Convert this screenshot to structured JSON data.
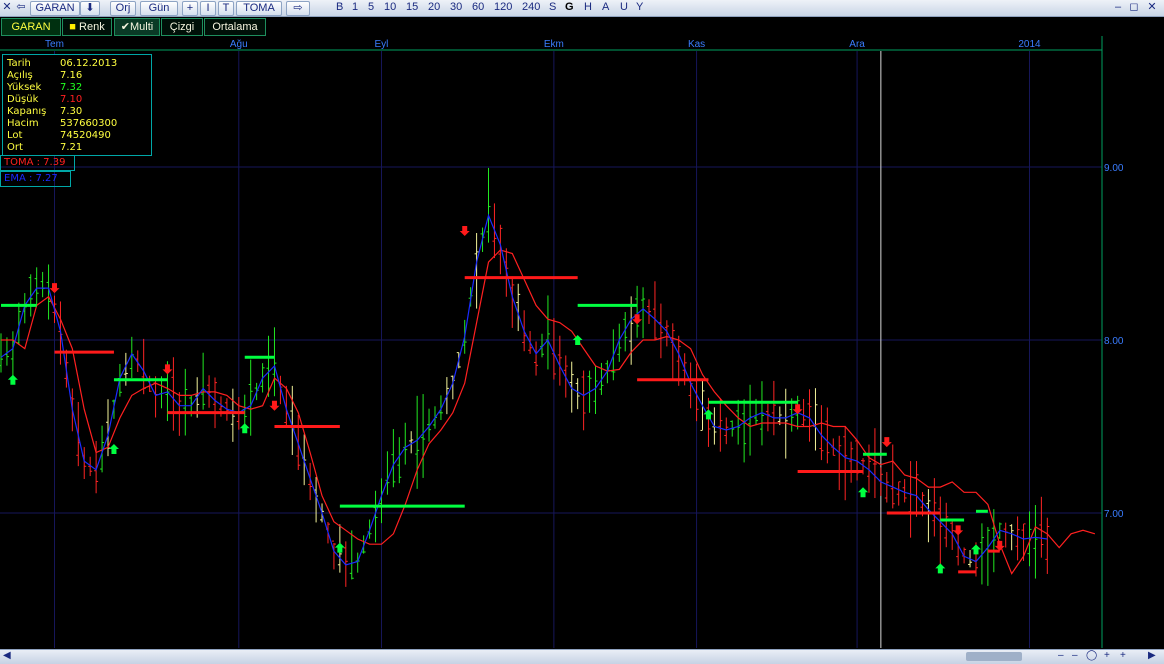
{
  "toolbar": {
    "symbol": "GARAN",
    "btn_orj": "Orj",
    "btn_gun": "Gün",
    "btn_plus": "+",
    "btn_i": "I",
    "btn_t": "T",
    "btn_toma": "TOMA",
    "periods": [
      "B",
      "1",
      "5",
      "10",
      "15",
      "20",
      "30",
      "60",
      "120",
      "240",
      "S",
      "G",
      "H",
      "A",
      "U",
      "Y"
    ]
  },
  "tabs": {
    "symbol": "GARAN",
    "renk": "Renk",
    "multi": "Multi",
    "cizgi": "Çizgi",
    "ortalama": "Ortalama"
  },
  "info": {
    "tarih_label": "Tarih",
    "tarih": "06.12.2013",
    "acilis_label": "Açılış",
    "acilis": "7.16",
    "yuksek_label": "Yüksek",
    "yuksek": "7.32",
    "dusuk_label": "Düşük",
    "dusuk": "7.10",
    "kapanis_label": "Kapanış",
    "kapanis": "7.30",
    "hacim_label": "Hacim",
    "hacim": "537660300",
    "lot_label": "Lot",
    "lot": "74520490",
    "ort_label": "Ort",
    "ort": "7.21"
  },
  "indicators": {
    "toma": "TOMA : 7.39",
    "ema": "EMA : 7.27"
  },
  "colors": {
    "background": "#000000",
    "grid": "#16165a",
    "axis_text": "#3a7dff",
    "axis_line": "#00a060",
    "toma": "#ff2020",
    "ema": "#1a2cff",
    "buy": "#00ff40",
    "sell": "#ff1a1a",
    "bar_green": "#21e821",
    "bar_red": "#ff2424",
    "bar_yellow": "#f3f39a"
  },
  "chart_data": {
    "type": "ohlc",
    "ylim": [
      6.22,
      9.67
    ],
    "y_ticks": [
      9.0,
      8.0,
      7.0
    ],
    "y_tick_labels": [
      "9.00",
      "8.00",
      "7.00"
    ],
    "x_labels": [
      {
        "label": "Tem",
        "index": 9
      },
      {
        "label": "Ağu",
        "index": 40
      },
      {
        "label": "Eyl",
        "index": 64
      },
      {
        "label": "Ekm",
        "index": 93
      },
      {
        "label": "Kas",
        "index": 117
      },
      {
        "label": "Ara",
        "index": 144
      },
      {
        "label": "2014",
        "index": 173
      }
    ],
    "cursor_index": 148,
    "toma_curve": [
      [
        0,
        8.0
      ],
      [
        2,
        8.0
      ],
      [
        4,
        7.95
      ],
      [
        6,
        8.2
      ],
      [
        8,
        8.25
      ],
      [
        10,
        8.12
      ],
      [
        12,
        7.95
      ],
      [
        14,
        7.6
      ],
      [
        16,
        7.35
      ],
      [
        18,
        7.38
      ],
      [
        20,
        7.55
      ],
      [
        22,
        7.68
      ],
      [
        24,
        7.72
      ],
      [
        26,
        7.75
      ],
      [
        28,
        7.72
      ],
      [
        30,
        7.68
      ],
      [
        32,
        7.68
      ],
      [
        34,
        7.7
      ],
      [
        36,
        7.7
      ],
      [
        38,
        7.68
      ],
      [
        40,
        7.62
      ],
      [
        42,
        7.6
      ],
      [
        44,
        7.62
      ],
      [
        46,
        7.78
      ],
      [
        48,
        7.72
      ],
      [
        50,
        7.58
      ],
      [
        52,
        7.35
      ],
      [
        54,
        7.1
      ],
      [
        56,
        6.95
      ],
      [
        58,
        6.9
      ],
      [
        60,
        6.85
      ],
      [
        62,
        6.82
      ],
      [
        64,
        6.82
      ],
      [
        66,
        6.88
      ],
      [
        68,
        7.05
      ],
      [
        70,
        7.25
      ],
      [
        72,
        7.4
      ],
      [
        74,
        7.48
      ],
      [
        76,
        7.58
      ],
      [
        78,
        7.75
      ],
      [
        80,
        8.1
      ],
      [
        82,
        8.45
      ],
      [
        84,
        8.52
      ],
      [
        86,
        8.5
      ],
      [
        88,
        8.35
      ],
      [
        90,
        8.2
      ],
      [
        92,
        8.12
      ],
      [
        94,
        8.1
      ],
      [
        96,
        8.05
      ],
      [
        98,
        7.95
      ],
      [
        100,
        7.85
      ],
      [
        102,
        7.82
      ],
      [
        104,
        7.83
      ],
      [
        106,
        7.93
      ],
      [
        108,
        8.0
      ],
      [
        110,
        8.0
      ],
      [
        112,
        8.02
      ],
      [
        114,
        8.0
      ],
      [
        116,
        7.95
      ],
      [
        118,
        7.8
      ],
      [
        120,
        7.7
      ],
      [
        122,
        7.62
      ],
      [
        124,
        7.55
      ],
      [
        126,
        7.5
      ],
      [
        128,
        7.52
      ],
      [
        130,
        7.52
      ],
      [
        132,
        7.52
      ],
      [
        134,
        7.5
      ],
      [
        136,
        7.5
      ],
      [
        138,
        7.52
      ],
      [
        140,
        7.5
      ],
      [
        142,
        7.5
      ],
      [
        144,
        7.42
      ],
      [
        146,
        7.32
      ],
      [
        148,
        7.28
      ],
      [
        150,
        7.3
      ],
      [
        152,
        7.22
      ],
      [
        154,
        7.2
      ],
      [
        156,
        7.15
      ],
      [
        158,
        7.15
      ],
      [
        160,
        7.18
      ],
      [
        162,
        7.12
      ],
      [
        164,
        7.12
      ],
      [
        166,
        7.05
      ],
      [
        168,
        6.82
      ],
      [
        170,
        6.65
      ],
      [
        172,
        6.75
      ],
      [
        174,
        6.92
      ],
      [
        176,
        6.88
      ],
      [
        178,
        6.8
      ],
      [
        180,
        6.88
      ],
      [
        182,
        6.9
      ],
      [
        184,
        6.88
      ]
    ],
    "ema_curve": [
      [
        0,
        7.9
      ],
      [
        2,
        7.95
      ],
      [
        4,
        8.2
      ],
      [
        6,
        8.3
      ],
      [
        8,
        8.3
      ],
      [
        10,
        8.05
      ],
      [
        12,
        7.6
      ],
      [
        14,
        7.3
      ],
      [
        16,
        7.25
      ],
      [
        18,
        7.45
      ],
      [
        20,
        7.78
      ],
      [
        22,
        7.92
      ],
      [
        24,
        7.82
      ],
      [
        26,
        7.68
      ],
      [
        28,
        7.7
      ],
      [
        30,
        7.62
      ],
      [
        32,
        7.62
      ],
      [
        34,
        7.72
      ],
      [
        36,
        7.65
      ],
      [
        38,
        7.6
      ],
      [
        40,
        7.58
      ],
      [
        42,
        7.62
      ],
      [
        44,
        7.78
      ],
      [
        46,
        7.85
      ],
      [
        48,
        7.6
      ],
      [
        50,
        7.4
      ],
      [
        52,
        7.2
      ],
      [
        54,
        7.0
      ],
      [
        56,
        6.78
      ],
      [
        58,
        6.7
      ],
      [
        60,
        6.72
      ],
      [
        62,
        6.9
      ],
      [
        64,
        7.1
      ],
      [
        66,
        7.28
      ],
      [
        68,
        7.38
      ],
      [
        70,
        7.42
      ],
      [
        72,
        7.5
      ],
      [
        74,
        7.6
      ],
      [
        76,
        7.75
      ],
      [
        78,
        8.02
      ],
      [
        80,
        8.45
      ],
      [
        82,
        8.72
      ],
      [
        84,
        8.55
      ],
      [
        86,
        8.25
      ],
      [
        88,
        8.05
      ],
      [
        90,
        7.92
      ],
      [
        92,
        8.0
      ],
      [
        94,
        7.85
      ],
      [
        96,
        7.72
      ],
      [
        98,
        7.68
      ],
      [
        100,
        7.72
      ],
      [
        102,
        7.82
      ],
      [
        104,
        8.0
      ],
      [
        106,
        8.12
      ],
      [
        108,
        8.18
      ],
      [
        110,
        8.12
      ],
      [
        112,
        8.05
      ],
      [
        114,
        7.92
      ],
      [
        116,
        7.75
      ],
      [
        118,
        7.62
      ],
      [
        120,
        7.5
      ],
      [
        122,
        7.48
      ],
      [
        124,
        7.5
      ],
      [
        126,
        7.55
      ],
      [
        128,
        7.58
      ],
      [
        130,
        7.55
      ],
      [
        132,
        7.55
      ],
      [
        134,
        7.58
      ],
      [
        136,
        7.55
      ],
      [
        138,
        7.45
      ],
      [
        140,
        7.38
      ],
      [
        142,
        7.32
      ],
      [
        144,
        7.3
      ],
      [
        146,
        7.25
      ],
      [
        148,
        7.18
      ],
      [
        150,
        7.15
      ],
      [
        152,
        7.12
      ],
      [
        154,
        7.1
      ],
      [
        156,
        7.02
      ],
      [
        158,
        6.95
      ],
      [
        160,
        6.88
      ],
      [
        162,
        6.75
      ],
      [
        164,
        6.72
      ],
      [
        166,
        6.8
      ],
      [
        168,
        6.9
      ],
      [
        170,
        6.88
      ],
      [
        172,
        6.85
      ],
      [
        174,
        6.86
      ],
      [
        176,
        6.85
      ]
    ],
    "signal_lines": [
      {
        "c": "buy",
        "i0": 0,
        "i1": 6,
        "v": 8.2
      },
      {
        "c": "sell",
        "i0": 9,
        "i1": 19,
        "v": 7.93
      },
      {
        "c": "buy",
        "i0": 19,
        "i1": 28,
        "v": 7.77
      },
      {
        "c": "sell",
        "i0": 28,
        "i1": 41,
        "v": 7.58
      },
      {
        "c": "buy",
        "i0": 41,
        "i1": 46,
        "v": 7.9
      },
      {
        "c": "sell",
        "i0": 46,
        "i1": 57,
        "v": 7.5
      },
      {
        "c": "buy",
        "i0": 57,
        "i1": 78,
        "v": 7.04
      },
      {
        "c": "sell",
        "i0": 78,
        "i1": 97,
        "v": 8.36
      },
      {
        "c": "buy",
        "i0": 97,
        "i1": 107,
        "v": 8.2
      },
      {
        "c": "sell",
        "i0": 107,
        "i1": 119,
        "v": 7.77
      },
      {
        "c": "buy",
        "i0": 119,
        "i1": 134,
        "v": 7.64
      },
      {
        "c": "sell",
        "i0": 134,
        "i1": 145,
        "v": 7.24
      },
      {
        "c": "buy",
        "i0": 145,
        "i1": 149,
        "v": 7.34
      },
      {
        "c": "sell",
        "i0": 149,
        "i1": 158,
        "v": 7.0
      },
      {
        "c": "buy",
        "i0": 158,
        "i1": 162,
        "v": 6.96
      },
      {
        "c": "sell",
        "i0": 161,
        "i1": 164,
        "v": 6.66
      },
      {
        "c": "buy",
        "i0": 164,
        "i1": 166,
        "v": 7.01
      },
      {
        "c": "sell",
        "i0": 166,
        "i1": 168,
        "v": 6.78
      }
    ],
    "arrows": [
      {
        "c": "buy",
        "i": 2,
        "v": 7.77
      },
      {
        "c": "sell",
        "i": 9,
        "v": 8.3
      },
      {
        "c": "buy",
        "i": 19,
        "v": 7.37
      },
      {
        "c": "sell",
        "i": 28,
        "v": 7.83
      },
      {
        "c": "buy",
        "i": 41,
        "v": 7.49
      },
      {
        "c": "sell",
        "i": 46,
        "v": 7.62
      },
      {
        "c": "buy",
        "i": 57,
        "v": 6.8
      },
      {
        "c": "sell",
        "i": 78,
        "v": 8.63
      },
      {
        "c": "buy",
        "i": 97,
        "v": 8.0
      },
      {
        "c": "sell",
        "i": 107,
        "v": 8.12
      },
      {
        "c": "buy",
        "i": 119,
        "v": 7.57
      },
      {
        "c": "sell",
        "i": 134,
        "v": 7.6
      },
      {
        "c": "buy",
        "i": 145,
        "v": 7.12
      },
      {
        "c": "sell",
        "i": 149,
        "v": 7.41
      },
      {
        "c": "buy",
        "i": 158,
        "v": 6.68
      },
      {
        "c": "sell",
        "i": 161,
        "v": 6.9
      },
      {
        "c": "buy",
        "i": 164,
        "v": 6.79
      },
      {
        "c": "sell",
        "i": 168,
        "v": 6.81
      }
    ]
  }
}
